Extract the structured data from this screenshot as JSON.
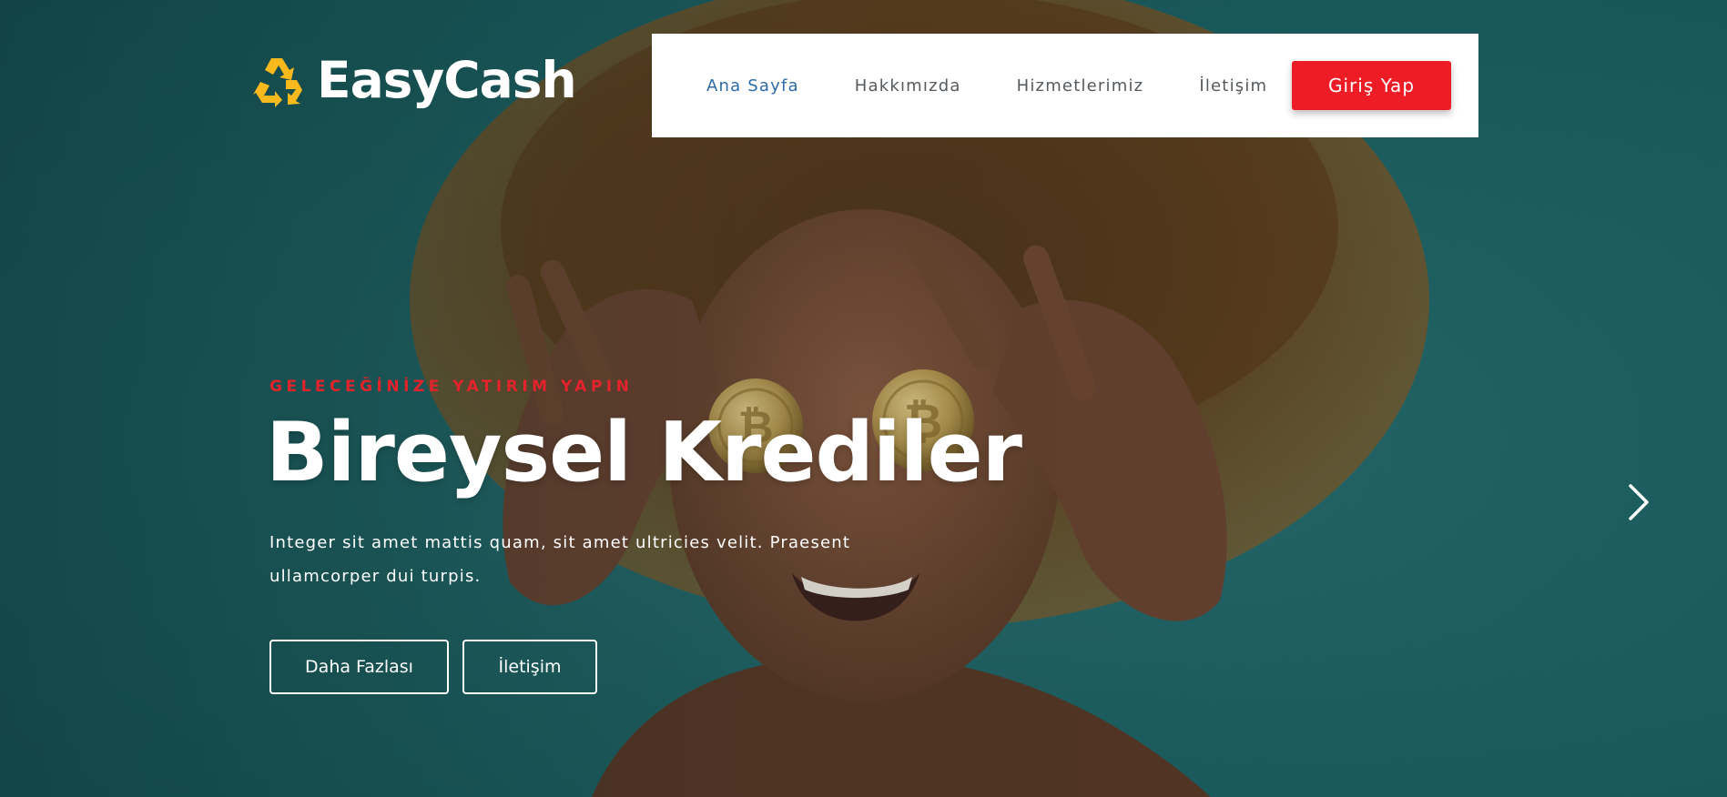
{
  "brand": {
    "name": "EasyCash",
    "logo_icon": "recycle-icon",
    "logo_color": "#f7b91c"
  },
  "nav": {
    "items": [
      {
        "label": "Ana Sayfa",
        "active": true
      },
      {
        "label": "Hakkımızda",
        "active": false
      },
      {
        "label": "Hizmetlerimiz",
        "active": false
      },
      {
        "label": "İletişim",
        "active": false
      }
    ],
    "login_label": "Giriş Yap",
    "active_color": "#2c6aa8",
    "login_color": "#ee1c25"
  },
  "hero": {
    "kicker": "GELECEĞİNİZE YATIRIM YAPIN",
    "title": "Bireysel Krediler",
    "description": "Integer sit amet mattis quam, sit amet ultricies velit. Praesent ullamcorper dui turpis.",
    "primary_button": "Daha Fazlası",
    "secondary_button": "İletişim",
    "next_icon": "chevron-right-icon",
    "background_color": "#1f6466",
    "kicker_color": "#e2232b"
  }
}
